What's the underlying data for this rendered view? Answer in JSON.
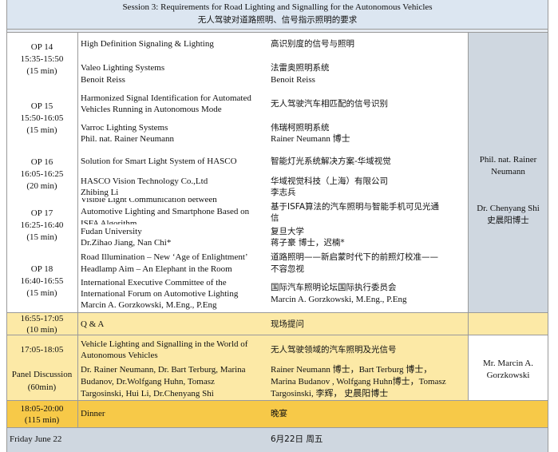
{
  "header": {
    "title_en": "Session 3: Requirements for Road Lighting and Signalling for the Autonomous Vehicles",
    "title_zh": "无人驾驶对道路照明、信号指示照明的要求"
  },
  "rows": [
    {
      "op": "OP 14",
      "time": "15:35-15:50",
      "dur": "(15 min)",
      "title_en": "High Definition Signaling & Lighting",
      "title_zh": "高识别度的信号与照明",
      "org_en": "Valeo Lighting Systems",
      "speaker_en": "Benoit Reiss",
      "org_zh": "法雷奥照明系统",
      "speaker_zh": "Benoit Reiss"
    },
    {
      "op": "OP 15",
      "time": "15:50-16:05",
      "dur": "(15 min)",
      "title_en_1": "Harmonized Signal Identification for Automated",
      "title_en_2": "Vehicles Running in Autonomous Mode",
      "title_zh": "无人驾驶汽车相匹配的信号识别",
      "org_en": "Varroc Lighting Systems",
      "speaker_en": "Phil. nat. Rainer Neumann",
      "org_zh": "伟瑞柯照明系统",
      "speaker_zh": "Rainer Neumann 博士"
    },
    {
      "op": "OP 16",
      "time": "16:05-16:25",
      "dur": "(20 min)",
      "title_en": "Solution for Smart Light System of HASCO",
      "title_zh": "智能灯光系统解决方案-华域视觉",
      "org_en": "HASCO Vision Technology Co.,Ltd",
      "speaker_en": "Zhibing Li",
      "org_zh": "华域视觉科技（上海）有限公司",
      "speaker_zh": "李志兵"
    },
    {
      "op": "OP 17",
      "time": "16:25-16:40",
      "dur": "(15 min)",
      "title_en_0": "Visible Light Communication between",
      "title_en_1": "Automotive Lighting and Smartphone Based on",
      "title_en_2": "ISFA Algorithm",
      "title_zh_1": "基于ISFA算法的汽车照明与智能手机可见光通",
      "title_zh_2": "信",
      "org_en": "Fudan University",
      "speaker_en": "Dr.Zihao Jiang, Nan Chi*",
      "org_zh": "复旦大学",
      "speaker_zh": "蒋子豪  博士，迟楠*"
    },
    {
      "op": "OP 18",
      "time": "16:40-16:55",
      "dur": "(15 min)",
      "title_en_1": "Road Illumination – New ‘Age of Enlightment’",
      "title_en_2": "Headlamp Aim – An Elephant in the Room",
      "title_zh_1": "道路照明——新启蒙时代下的前照灯校准——",
      "title_zh_2": "不容忽视",
      "org_en_1": "International Executive Committee of the",
      "org_en_2": "International Forum on Automotive Lighting",
      "speaker_en": "Marcin A. Gorzkowski, M.Eng., P.Eng",
      "org_zh": "国际汽车照明论坛国际执行委员会",
      "speaker_zh": "Marcin A. Gorzkowski, M.Eng., P.Eng"
    }
  ],
  "chairs_1": {
    "name1_1": "Phil. nat. Rainer",
    "name1_2": "Neumann",
    "name2_en": "Dr. Chenyang Shi",
    "name2_zh": "史晨阳博士"
  },
  "qa": {
    "time": "16:55-17:05",
    "dur": "(10 min)",
    "title_en": "Q & A",
    "title_zh": "现场提问"
  },
  "panel": {
    "time": "17:05-18:05",
    "label": "Panel Discussion",
    "dur": "(60min)",
    "title_en_1": "Vehicle Lighting and Signalling in the World of",
    "title_en_2": "Autonomous Vehicles",
    "title_zh": "无人驾驶领域的汽车照明及光信号",
    "people_en_1": "Dr. Rainer Neumann, Dr. Bart Terburg, Marina",
    "people_en_2": "Budanov, Dr.Wolfgang Huhn, Tomasz",
    "people_en_3": "Targosinski, Hui Li, Dr.Chenyang Shi",
    "people_zh_1": "Rainer Neumann 博士，Bart Terburg 博士，",
    "people_zh_2": "Marina Budanov , Wolfgang Huhn博士，Tomasz",
    "people_zh_3": "Targosinski, 李辉， 史晨阳博士",
    "chair_1": "Mr. Marcin A.",
    "chair_2": "Gorzkowski"
  },
  "dinner": {
    "time": "18:05-20:00",
    "dur": "(115 min)",
    "title_en": "Dinner",
    "title_zh": "晚宴"
  },
  "footer": {
    "day_en": "Friday  June 22",
    "day_zh": "6月22日 周五"
  }
}
